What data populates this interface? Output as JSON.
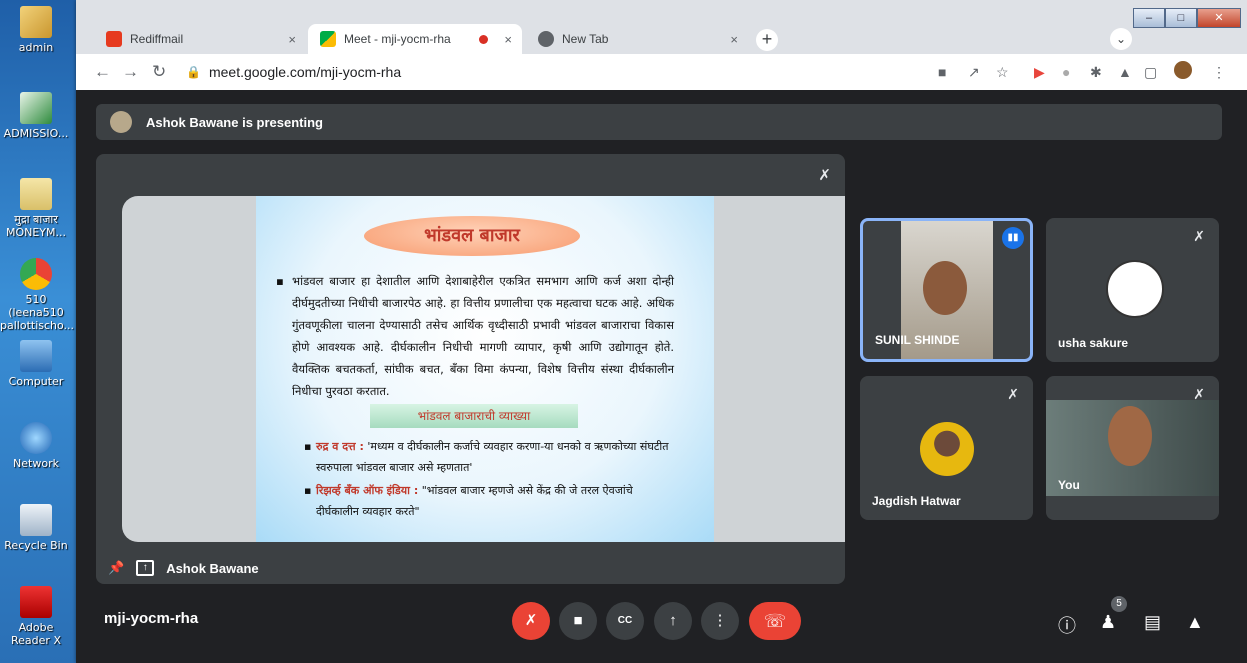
{
  "desktop": {
    "icons": [
      {
        "label": "admin",
        "icon": "user-folder-icon"
      },
      {
        "label": "ADMISSIO...",
        "icon": "excel-icon"
      },
      {
        "label": "मुद्रा बाजार MONEYM...",
        "icon": "document-thumbnail-icon"
      },
      {
        "label": "510 (leena510 pallottischo...",
        "icon": "chrome-icon"
      },
      {
        "label": "Computer",
        "icon": "computer-icon"
      },
      {
        "label": "Network",
        "icon": "network-icon"
      },
      {
        "label": "Recycle Bin",
        "icon": "recycle-bin-icon"
      },
      {
        "label": "Adobe Reader X",
        "icon": "adobe-reader-icon"
      }
    ]
  },
  "browser": {
    "tabs": [
      {
        "title": "Rediffmail",
        "icon": "rediffmail-icon",
        "active": false,
        "close": "×"
      },
      {
        "title": "Meet - mji-yocm-rha",
        "icon": "meet-icon",
        "active": true,
        "close": "×"
      },
      {
        "title": "New Tab",
        "icon": "chrome-icon",
        "active": false,
        "close": "×"
      }
    ],
    "new_tab": "+",
    "url": "meet.google.com/mji-yocm-rha"
  },
  "meet": {
    "presenting_banner": "Ashok Bawane is presenting",
    "main_tile_name": "Ashok Bawane",
    "slide": {
      "title": "भांडवल बाजार",
      "paragraph": "भांडवल बाजार हा देशातील आणि देशाबाहेरील एकत्रित समभाग आणि कर्ज अशा दोन्ही दीर्घमुदतीच्या निधीची बाजारपेठ आहे. हा वित्तीय प्रणालीचा एक महत्वाचा घटक आहे. अधिक गुंतवणूकीला चालना देण्यासाठी तसेच आर्थिक वृध्दीसाठी प्रभावी भांडवल बाजाराचा विकास होणे आवश्यक आहे. दीर्घकालीन निधीची मागणी व्यापार, कृषी आणि उद्योगातून होते. वैयक्तिक बचतकर्ता, सांघीक बचत, बँका विमा कंपन्या, विशेष वित्तीय संस्था दीर्घकालीन निधीचा पुरवठा करतात.",
      "definition_heading": "भांडवल बाजाराची व्याख्या",
      "bullets": [
        {
          "key": "रुद्र व दत्त :",
          "text": "'मध्यम व दीर्घकालीन कर्जाचे व्यवहार करणा-या धनको व ऋणकोच्या संघटीत स्वरुपाला भांडवल बाजार असे म्हणतात'"
        },
        {
          "key": "रिझर्व्ह बँक ऑफ इंडिया :",
          "text": "\"भांडवल बाजार म्हणजे असे केंद्र की जे तरल ऐवजांचे दीर्घकालीन व्यवहार करते\""
        }
      ]
    },
    "participants": [
      {
        "name": "SUNIL SHINDE",
        "speaking": true
      },
      {
        "name": "usha sakure",
        "muted": true
      },
      {
        "name": "Jagdish Hatwar",
        "muted": true
      },
      {
        "name": "You",
        "muted": true
      }
    ],
    "meeting_code": "mji-yocm-rha",
    "people_count": "5"
  }
}
